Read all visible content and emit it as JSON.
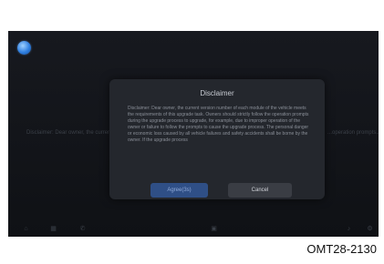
{
  "dialog": {
    "title": "Disclaimer",
    "body": "Disclaimer: Dear owner, the current version number of each module of the vehicle meets the requirements of this upgrade task. Owners should strictly follow the operation prompts during the upgrade process to upgrade, for example, due to improper operation of the owner or failure to follow the prompts to cause the upgrade process. The personal danger or economic loss caused by all vehicle failures and safety accidents shall be borne by the owner. If the upgrade process",
    "agree_label": "Agree(3s)",
    "cancel_label": "Cancel"
  },
  "background": {
    "text_left": "Disclaimer: Dear owner, the current version number of each module... the requirements of this upgrade task...",
    "text_right": "...operation prompts... during the upgrade process..."
  },
  "caption": "OMT28-2130",
  "icons": {
    "status_top_left": "globe-icon",
    "dock": [
      "home-icon",
      "apps-icon",
      "phone-icon",
      "media-icon",
      "music-icon",
      "settings-icon"
    ]
  },
  "colors": {
    "screen_bg": "#121419",
    "dialog_bg": "#24272d",
    "agree_button": "#2f4f86",
    "cancel_button": "#3a3d44"
  }
}
